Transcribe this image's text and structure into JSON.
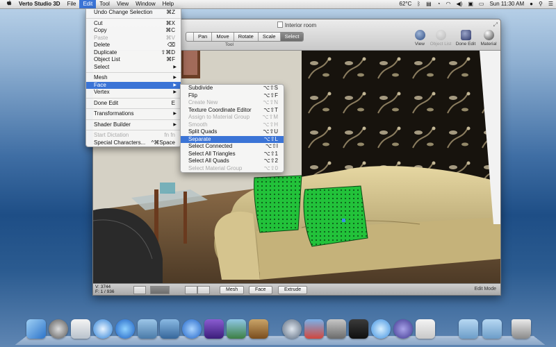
{
  "menubar": {
    "app_name": "Verto Studio 3D",
    "items": [
      "File",
      "Edit",
      "Tool",
      "View",
      "Window",
      "Help"
    ],
    "status": {
      "temperature": "62°C",
      "clock": "Sun 11:30 AM"
    }
  },
  "window": {
    "title": "Interior room",
    "tool_buttons": [
      "Pan",
      "Move",
      "Rotate",
      "Scale",
      "Select"
    ],
    "tool_caption": "Tool",
    "right_tools": [
      "View",
      "Object List",
      "Done Edit",
      "Material"
    ]
  },
  "edit_menu": {
    "undo": {
      "label": "Undo Change Selection",
      "shortcut": "⌘Z"
    },
    "cut": {
      "label": "Cut",
      "shortcut": "⌘X"
    },
    "copy": {
      "label": "Copy",
      "shortcut": "⌘C"
    },
    "paste": {
      "label": "Paste",
      "shortcut": "⌘V"
    },
    "delete": {
      "label": "Delete",
      "shortcut": "⌫"
    },
    "duplicate": {
      "label": "Duplicate",
      "shortcut": "⇧⌘D"
    },
    "object_list": {
      "label": "Object List",
      "shortcut": "⌘F"
    },
    "select": {
      "label": "Select"
    },
    "mesh": {
      "label": "Mesh"
    },
    "face": {
      "label": "Face"
    },
    "vertex": {
      "label": "Vertex"
    },
    "done_edit": {
      "label": "Done Edit",
      "shortcut": "E"
    },
    "transformations": {
      "label": "Transformations"
    },
    "shader_builder": {
      "label": "Shader Builder"
    },
    "start_dictation": {
      "label": "Start Dictation",
      "shortcut": "fn fn"
    },
    "special_characters": {
      "label": "Special Characters...",
      "shortcut": "^⌘Space"
    }
  },
  "face_menu": {
    "subdivide": {
      "label": "Subdivide",
      "shortcut": "⌥⇧S"
    },
    "flip": {
      "label": "Flip",
      "shortcut": "⌥⇧F"
    },
    "create_new": {
      "label": "Create New",
      "shortcut": "⌥⇧N"
    },
    "texture_coord": {
      "label": "Texture Coordinate Editor",
      "shortcut": "⌥⇧T"
    },
    "assign_material": {
      "label": "Assign to Material Group",
      "shortcut": "⌥⇧M"
    },
    "smooth": {
      "label": "Smooth",
      "shortcut": "⌥⇧H"
    },
    "split_quads": {
      "label": "Split Quads",
      "shortcut": "⌥⇧U"
    },
    "separate": {
      "label": "Separate",
      "shortcut": "⌥⇧L"
    },
    "select_connected": {
      "label": "Select Connected",
      "shortcut": "⌥⇧I"
    },
    "select_all_triangles": {
      "label": "Select All Triangles",
      "shortcut": "⌥⇧1"
    },
    "select_all_quads": {
      "label": "Select All Quads",
      "shortcut": "⌥⇧2"
    },
    "select_material_group": {
      "label": "Select Material Group",
      "shortcut": "⌥⇧0"
    }
  },
  "bottom": {
    "vertices": "V: 3744",
    "faces": "F: 1 / 936",
    "modes": [
      "Mesh",
      "Face",
      "Extrude"
    ],
    "mode_label": "Edit Mode"
  },
  "colors": {
    "menu_highlight": "#3b74d6",
    "pillow_green": "#21c43b",
    "sofa": "#c8b57c"
  }
}
